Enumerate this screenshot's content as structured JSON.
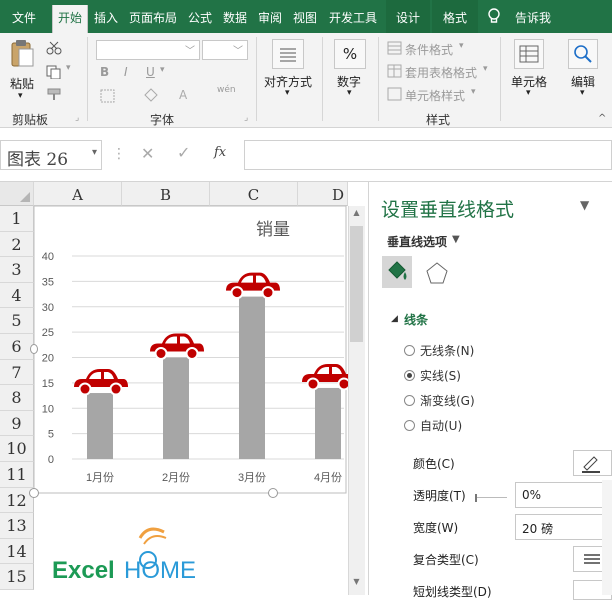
{
  "ribbon_tabs": [
    {
      "label": "文件",
      "active": false
    },
    {
      "label": "开始",
      "active": true
    },
    {
      "label": "插入",
      "active": false
    },
    {
      "label": "页面布局",
      "active": false
    },
    {
      "label": "公式",
      "active": false
    },
    {
      "label": "数据",
      "active": false
    },
    {
      "label": "审阅",
      "active": false
    },
    {
      "label": "视图",
      "active": false
    },
    {
      "label": "开发工具",
      "active": false
    },
    {
      "label": "设计",
      "active": false
    },
    {
      "label": "格式",
      "active": false
    },
    {
      "label": "告诉我",
      "active": false
    }
  ],
  "ribbon": {
    "paste_label": "粘贴",
    "clipboard_group": "剪贴板",
    "font_group": "字体",
    "font_bold": "B",
    "font_italic": "I",
    "font_underline": "U",
    "wen_label": "wén",
    "align_label": "对齐方式",
    "number_symbol": "%",
    "number_label": "数字",
    "cond_format": "条件格式",
    "table_format": "套用表格格式",
    "cell_style": "单元格样式",
    "styles_group": "样式",
    "cells_label": "单元格",
    "edit_label": "编辑"
  },
  "formula_bar": {
    "name_box": "图表 26",
    "fx": "fx",
    "value": ""
  },
  "grid": {
    "columns": [
      "A",
      "B",
      "C",
      "D"
    ],
    "rows": [
      "1",
      "2",
      "3",
      "4",
      "5",
      "6",
      "7",
      "8",
      "9",
      "10",
      "11",
      "12",
      "13",
      "14",
      "15"
    ]
  },
  "chart_data": {
    "type": "bar",
    "title": "销量",
    "categories": [
      "1月份",
      "2月份",
      "3月份",
      "4月份"
    ],
    "values": [
      13,
      20,
      32,
      14
    ],
    "ylim": [
      0,
      40
    ],
    "yticks": [
      0,
      5,
      10,
      15,
      20,
      25,
      30,
      35,
      40
    ],
    "grid": true,
    "bar_color": "#a6a6a6",
    "marker_color": "#c00000",
    "marker_icon": "car-icon"
  },
  "logo": {
    "text_a": "Excel",
    "text_b": "HOME"
  },
  "pane": {
    "title": "设置垂直线格式",
    "options_label": "垂直线选项",
    "section": "线条",
    "line_options": [
      {
        "label": "无线条(N)",
        "selected": false
      },
      {
        "label": "实线(S)",
        "selected": true
      },
      {
        "label": "渐变线(G)",
        "selected": false
      },
      {
        "label": "自动(U)",
        "selected": false
      }
    ],
    "color_label": "颜色(C)",
    "transparency_label": "透明度(T)",
    "transparency_value": "0%",
    "width_label": "宽度(W)",
    "width_value": "20 磅",
    "compound_label": "复合类型(C)",
    "dash_label": "短划线类型(D)"
  },
  "colors": {
    "excel_green": "#217346",
    "pane_title": "#217346",
    "accent_red": "#c00000"
  }
}
